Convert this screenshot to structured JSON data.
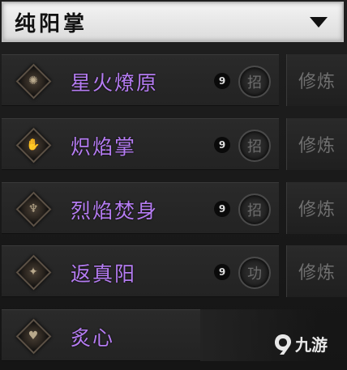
{
  "header": {
    "title": "纯阳掌"
  },
  "skills": [
    {
      "name": "星火燎原",
      "level": "9",
      "type": "招",
      "action": "修炼",
      "icon": "flame-burst-icon"
    },
    {
      "name": "炽焰掌",
      "level": "9",
      "type": "招",
      "action": "修炼",
      "icon": "flame-palm-icon"
    },
    {
      "name": "烈焰焚身",
      "level": "9",
      "type": "招",
      "action": "修炼",
      "icon": "burning-body-icon"
    },
    {
      "name": "返真阳",
      "level": "9",
      "type": "功",
      "action": "修炼",
      "icon": "true-yang-icon"
    },
    {
      "name": "炙心",
      "icon": "heart-icon"
    }
  ],
  "watermark": {
    "text": "九游"
  },
  "colors": {
    "skill_name": "#b57cf2",
    "header_bg": "#e6e6e6",
    "panel_bg": "#232323"
  }
}
